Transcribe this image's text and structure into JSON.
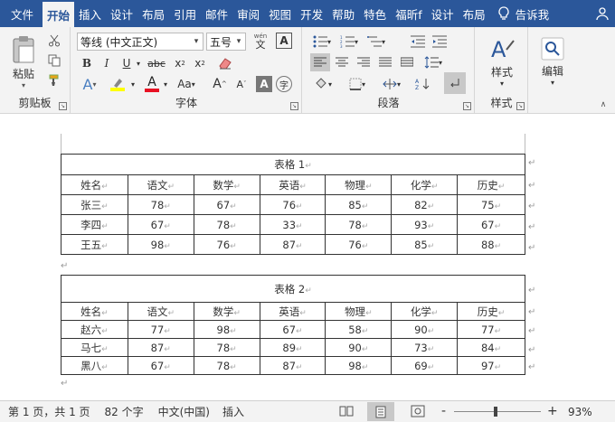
{
  "tabs": [
    "文件",
    "开始",
    "插入",
    "设计",
    "布局",
    "引用",
    "邮件",
    "审阅",
    "视图",
    "开发",
    "帮助",
    "特色",
    "福昕f",
    "设计",
    "布局"
  ],
  "tell_me": "告诉我",
  "ribbon": {
    "clipboard": {
      "paste": "粘贴",
      "label": "剪贴板"
    },
    "font": {
      "name": "等线 (中文正文)",
      "size": "五号",
      "label": "字体",
      "wen": "wén",
      "wen2": "文"
    },
    "paragraph": {
      "label": "段落"
    },
    "styles": {
      "button": "样式",
      "label": "样式"
    },
    "editing": {
      "button": "编辑"
    }
  },
  "tables": [
    {
      "caption": "表格 1",
      "headers": [
        "姓名",
        "语文",
        "数学",
        "英语",
        "物理",
        "化学",
        "历史"
      ],
      "rows": [
        [
          "张三",
          "78",
          "67",
          "76",
          "85",
          "82",
          "75"
        ],
        [
          "李四",
          "67",
          "78",
          "33",
          "78",
          "93",
          "67"
        ],
        [
          "王五",
          "98",
          "76",
          "87",
          "76",
          "85",
          "88"
        ]
      ]
    },
    {
      "caption": "表格 2",
      "headers": [
        "姓名",
        "语文",
        "数学",
        "英语",
        "物理",
        "化学",
        "历史"
      ],
      "rows": [
        [
          "赵六",
          "77",
          "98",
          "67",
          "58",
          "90",
          "77"
        ],
        [
          "马七",
          "87",
          "78",
          "89",
          "90",
          "73",
          "84"
        ],
        [
          "黑八",
          "67",
          "78",
          "87",
          "98",
          "69",
          "97"
        ]
      ]
    }
  ],
  "status": {
    "page": "第 1 页，共 1 页",
    "words": "82 个字",
    "language": "中文(中国)",
    "mode": "插入",
    "zoom": "93%",
    "zoom_minus": "-",
    "zoom_plus": "+"
  },
  "colors": {
    "accent": "#2b579a",
    "highlight": "#ffff00",
    "font_color": "#e81123"
  }
}
